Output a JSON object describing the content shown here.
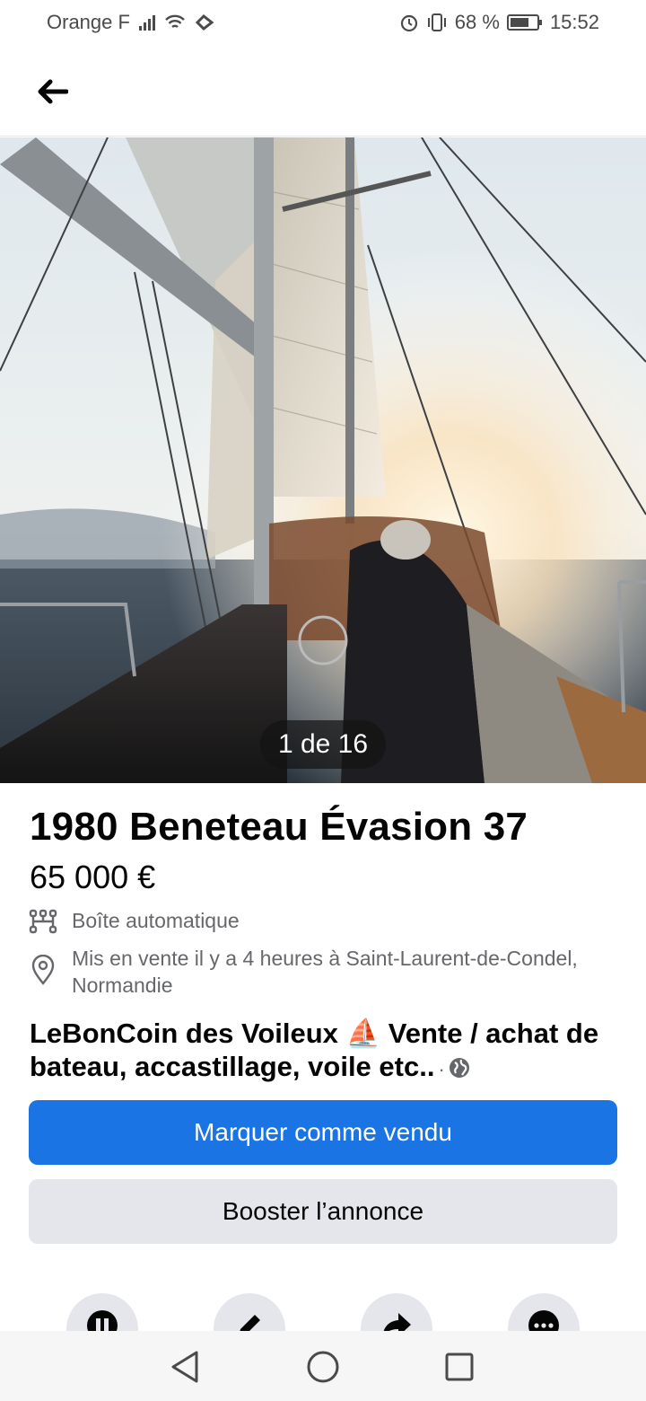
{
  "status_bar": {
    "carrier": "Orange F",
    "battery": "68 %",
    "time": "15:52"
  },
  "header": {
    "back_icon": "arrow-left-icon"
  },
  "photo": {
    "description_icon": "sailboat-photo",
    "counter": "1 de 16"
  },
  "listing": {
    "title": "1980 Beneteau Évasion 37",
    "price": "65 000 €",
    "transmission": "Boîte automatique",
    "location": "Mis en vente il y a 4 heures à Saint-Laurent-de-Condel, Normandie"
  },
  "group": {
    "name_part1": "LeBonCoin des Voileux",
    "emoji": "⛵",
    "name_part2": "Vente / achat de bateau, accastillage, voile etc..",
    "separator": "·",
    "visibility_icon": "globe-icon"
  },
  "buttons": {
    "mark_sold": "Marquer comme vendu",
    "boost": "Booster l’annonce"
  },
  "actions": [
    "pause-icon",
    "edit-icon",
    "share-icon",
    "more-icon"
  ],
  "colors": {
    "primary": "#1b74e4",
    "secondary_bg": "#e4e6eb",
    "text": "#050505",
    "muted": "#65676b"
  }
}
